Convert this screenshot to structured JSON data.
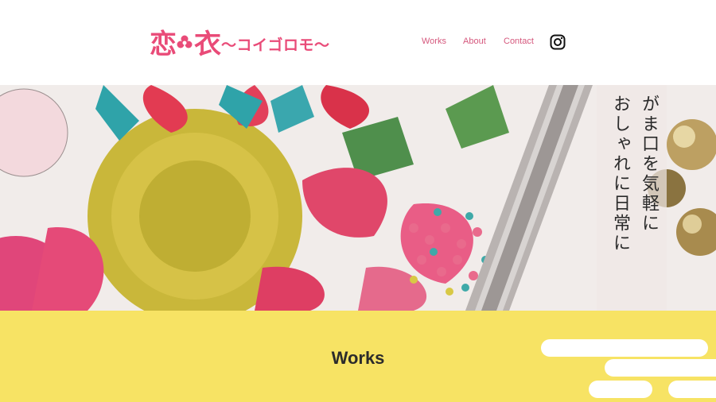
{
  "logo": {
    "kanji_left": "恋",
    "kanji_right": "衣",
    "kana": "〜コイゴロモ〜"
  },
  "nav": {
    "works": "Works",
    "about": "About",
    "contact": "Contact"
  },
  "social": {
    "icon": "instagram-icon"
  },
  "hero": {
    "tagline_col1": "がま口を気軽に",
    "tagline_col2": "おしゃれに日常に"
  },
  "section": {
    "title": "Works"
  },
  "colors": {
    "accent_pink": "#e94b78",
    "section_yellow": "#f7e364",
    "nav_pink": "#d5587d"
  }
}
